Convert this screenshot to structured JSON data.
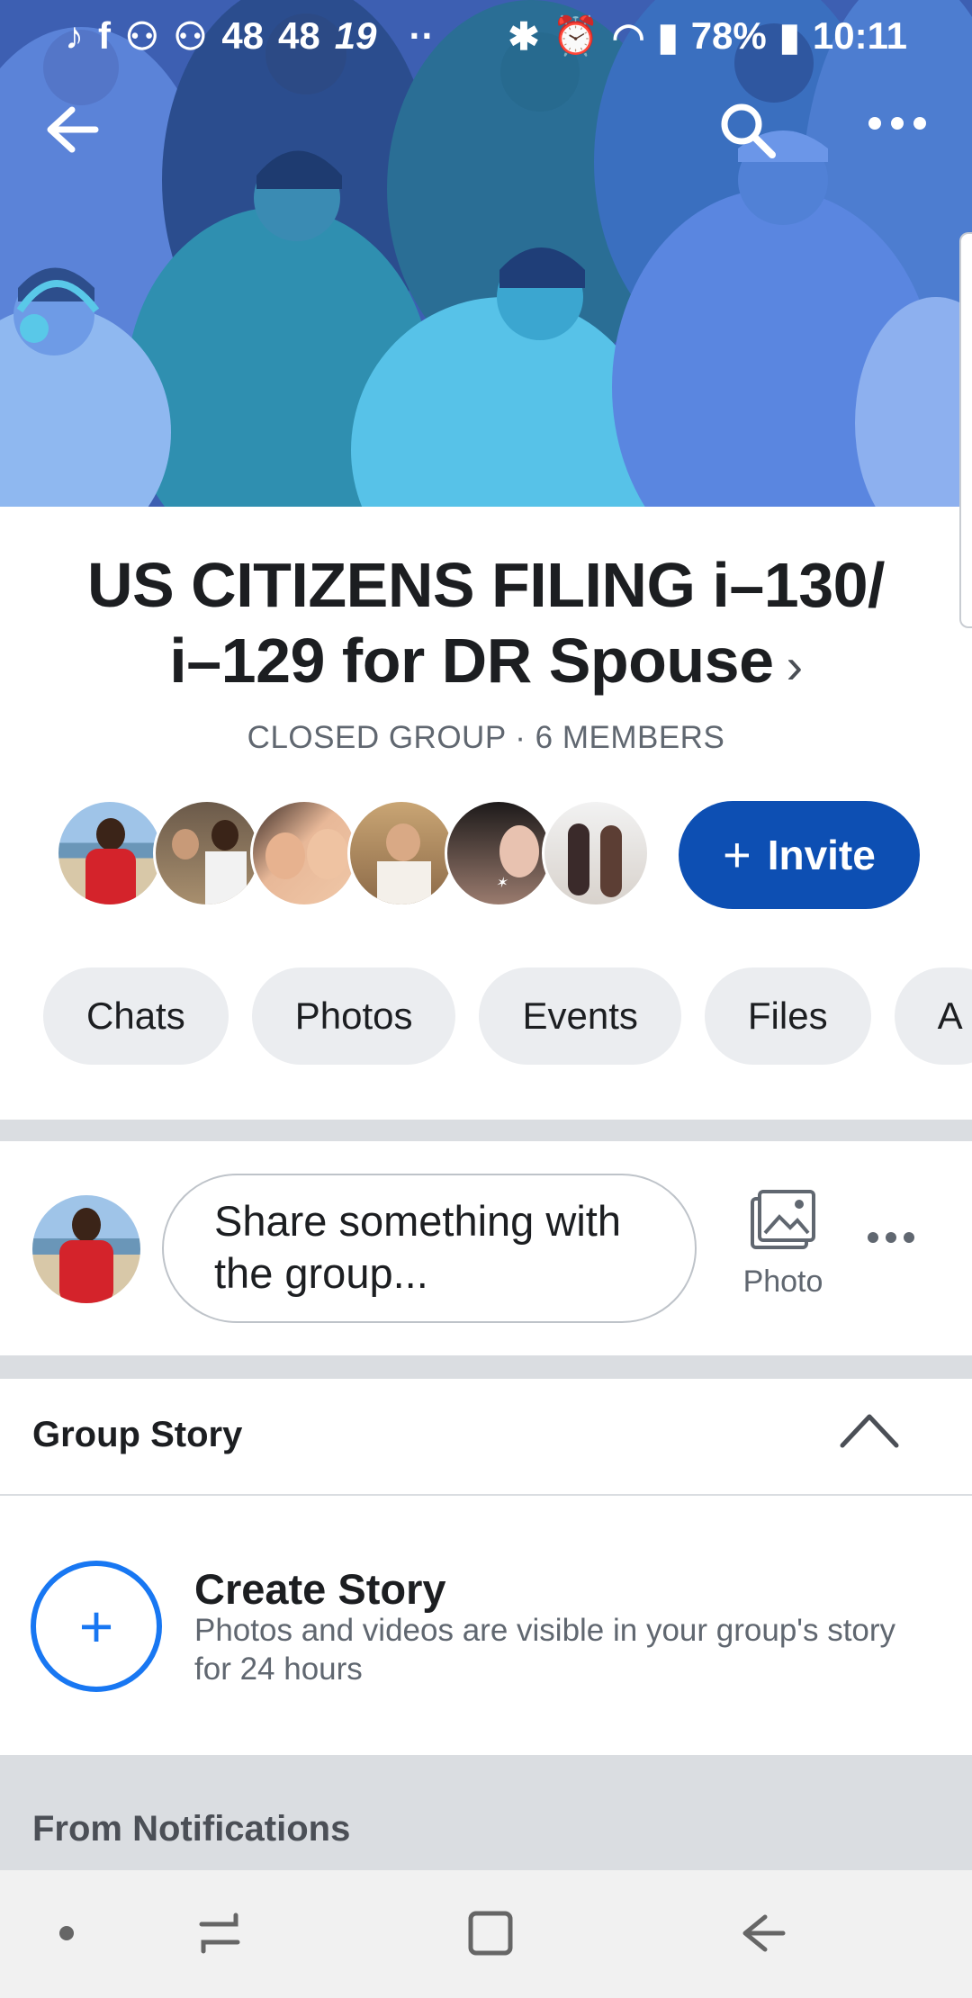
{
  "status_bar": {
    "notif_icons": [
      "music-icon",
      "facebook-icon",
      "android-icon",
      "android-icon"
    ],
    "notif_text_1": "48",
    "notif_text_2": "48",
    "notif_text_3": "19",
    "dots": "··",
    "battery": "78%",
    "time": "10:11"
  },
  "group": {
    "title_line1": "US CITIZENS FILING i–130/",
    "title_line2": "i–129 for DR Spouse",
    "chevron": "›",
    "meta": "CLOSED GROUP · 6 MEMBERS"
  },
  "invite_button": {
    "plus": "+",
    "label": "Invite"
  },
  "tabs": [
    {
      "label": "Chats"
    },
    {
      "label": "Photos"
    },
    {
      "label": "Events"
    },
    {
      "label": "Files"
    },
    {
      "label": "A"
    }
  ],
  "composer": {
    "placeholder_line1": "Share something with",
    "placeholder_line2": "the group...",
    "photo_label": "Photo"
  },
  "group_story": {
    "title": "Group Story",
    "create_title": "Create Story",
    "create_subtitle": "Photos and videos are visible in your group's story for 24 hours",
    "plus": "+"
  },
  "notifications": {
    "title": "From Notifications"
  },
  "colors": {
    "primary": "#0d4fb3",
    "accent": "#1877f2",
    "cover_bg": "#3b5fb0",
    "pill_bg": "#ebedf0"
  },
  "nav_icons": [
    "dot-icon",
    "recents-icon",
    "home-square-icon",
    "back-arrow-icon"
  ]
}
